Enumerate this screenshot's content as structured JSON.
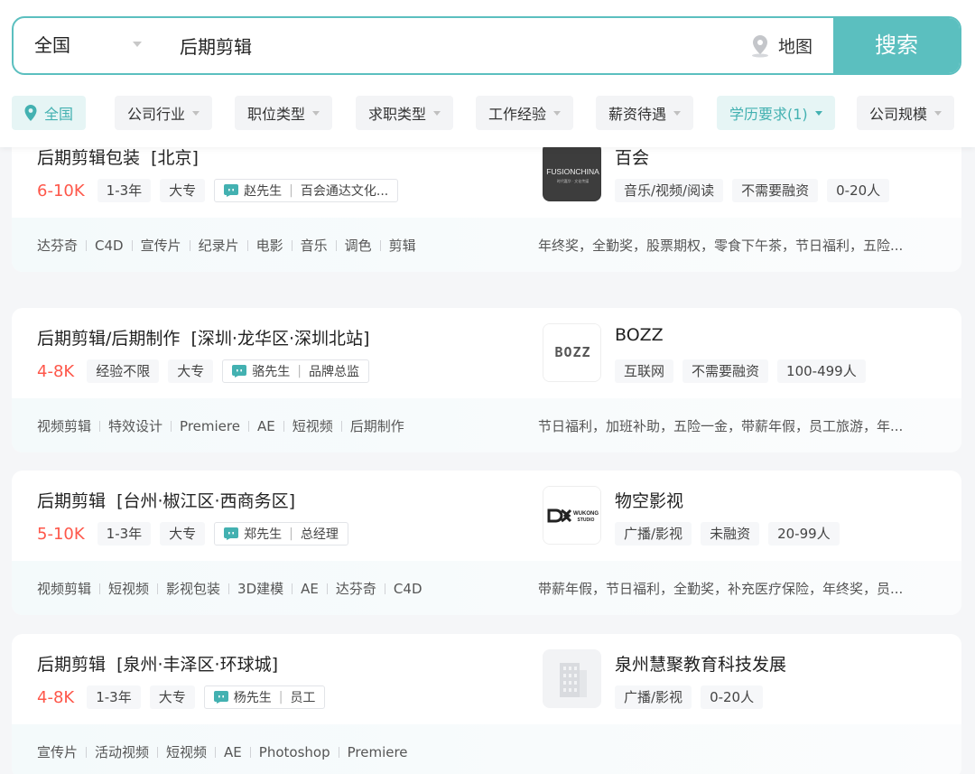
{
  "search": {
    "city": "全国",
    "query": "后期剪辑",
    "map_label": "地图",
    "button_label": "搜索"
  },
  "filters": [
    {
      "label": "全国",
      "active": true
    },
    {
      "label": "公司行业"
    },
    {
      "label": "职位类型"
    },
    {
      "label": "求职类型"
    },
    {
      "label": "工作经验"
    },
    {
      "label": "薪资待遇"
    },
    {
      "label": "学历要求(1)",
      "active": true
    },
    {
      "label": "公司规模"
    }
  ],
  "jobs": [
    {
      "title": "后期剪辑包装",
      "location": "[北京]",
      "salary": "6-10K",
      "experience": "1-3年",
      "education": "大专",
      "recruiter_name": "赵先生",
      "recruiter_title": "百会通达文化...",
      "skills": [
        "达芬奇",
        "C4D",
        "宣传片",
        "纪录片",
        "电影",
        "音乐",
        "调色",
        "剪辑"
      ],
      "company": "百会",
      "company_tags": [
        "音乐/视频/阅读",
        "不需要融资",
        "0-20人"
      ],
      "benefits": "年终奖，全勤奖，股票期权，零食下午茶，节日福利，五险...",
      "logo_text": "FUSIONCHINA",
      "logo_subtext": "时代嘉华 · 文化传媒"
    },
    {
      "title": "后期剪辑/后期制作",
      "location": "[深圳·龙华区·深圳北站]",
      "salary": "4-8K",
      "experience": "经验不限",
      "education": "大专",
      "recruiter_name": "骆先生",
      "recruiter_title": "品牌总监",
      "skills": [
        "视频剪辑",
        "特效设计",
        "Premiere",
        "AE",
        "短视频",
        "后期制作"
      ],
      "company": "BOZZ",
      "company_tags": [
        "互联网",
        "不需要融资",
        "100-499人"
      ],
      "benefits": "节日福利，加班补助，五险一金，带薪年假，员工旅游，年...",
      "logo_text": "BOZZ"
    },
    {
      "title": "后期剪辑",
      "location": "[台州·椒江区·西商务区]",
      "salary": "5-10K",
      "experience": "1-3年",
      "education": "大专",
      "recruiter_name": "郑先生",
      "recruiter_title": "总经理",
      "skills": [
        "视频剪辑",
        "短视频",
        "影视包装",
        "3D建模",
        "AE",
        "达芬奇",
        "C4D"
      ],
      "company": "物空影视",
      "company_tags": [
        "广播/影视",
        "未融资",
        "20-99人"
      ],
      "benefits": "带薪年假，节日福利，全勤奖，补充医疗保险，年终奖，员...",
      "logo_text": "WUKONG",
      "logo_subtext": "STUDIO"
    },
    {
      "title": "后期剪辑",
      "location": "[泉州·丰泽区·环球城]",
      "salary": "4-8K",
      "experience": "1-3年",
      "education": "大专",
      "recruiter_name": "杨先生",
      "recruiter_title": "员工",
      "skills": [
        "宣传片",
        "活动视频",
        "短视频",
        "AE",
        "Photoshop",
        "Premiere"
      ],
      "company": "泉州慧聚教育科技发展",
      "company_tags": [
        "广播/影视",
        "0-20人"
      ],
      "benefits": "",
      "logo_text": ""
    }
  ],
  "colors": {
    "accent": "#5bbfbf",
    "salary": "#fe574a"
  }
}
